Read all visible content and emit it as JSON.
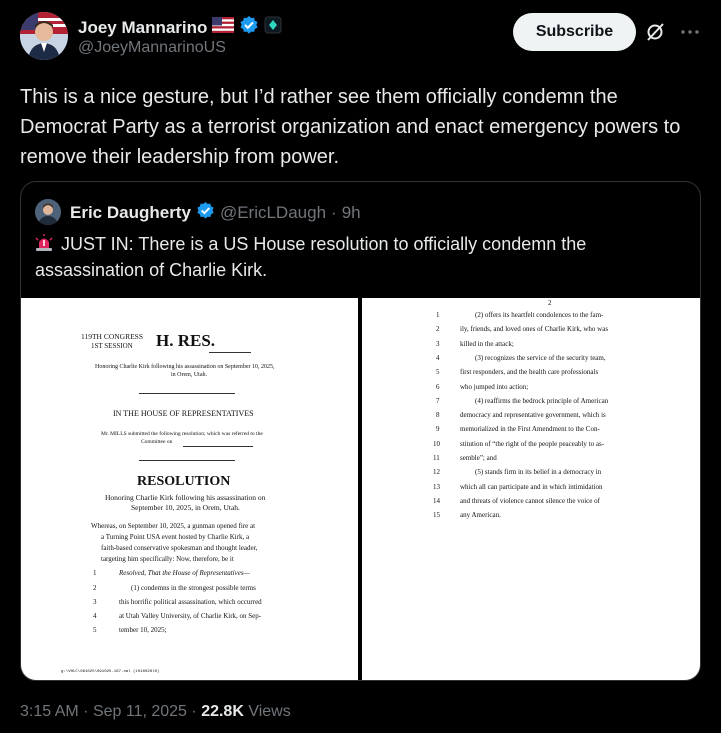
{
  "author": {
    "name": "Joey Mannarino",
    "handle": "@JoeyMannarinoUS"
  },
  "actions": {
    "subscribe_label": "Subscribe",
    "more_icon": "more-icon",
    "grok_icon": "grok-icon"
  },
  "tweet_text": "This is a nice gesture, but I’d rather see them officially condemn the Democrat Party as a terrorist organization and enact emergency powers to remove their leadership from power.",
  "quote": {
    "name": "Eric Daugherty",
    "handle": "@EricLDaugh",
    "sep": "·",
    "time": "9h",
    "text": "JUST IN: There is a US House resolution to officially condemn the assassination of Charlie Kirk."
  },
  "doc1": {
    "congress_line1": "119TH CONGRESS",
    "congress_line2": "1ST SESSION",
    "hres": "H. RES.",
    "subtitle_line1": "Honoring Charlie Kirk following his assassination on September 10, 2025,",
    "subtitle_line2": "in Orem, Utah.",
    "house": "IN THE HOUSE OF REPRESENTATIVES",
    "submitted_line1": "Mr. MILLS submitted the following resolution; which was referred to the",
    "submitted_line2": "Committee on",
    "resolution": "RESOLUTION",
    "honoring_line1": "Honoring Charlie Kirk following his assassination on",
    "honoring_line2": "September 10, 2025, in Orem, Utah.",
    "whereas": [
      "Whereas, on September 10, 2025, a gunman opened fire at",
      "a Turning Point USA event hosted by Charlie Kirk, a",
      "faith-based conservative spokesman and thought leader,",
      "targeting him specifically: Now, therefore, be it"
    ],
    "numbered": [
      {
        "n": "1",
        "t": "Resolved, That the House of Representatives—"
      },
      {
        "n": "2",
        "t": "(1) condemns in the strongest possible terms"
      },
      {
        "n": "3",
        "t": "this horrific political assassination, which occurred"
      },
      {
        "n": "4",
        "t": "at Utah Valley University, of Charlie Kirk, on Sep-"
      },
      {
        "n": "5",
        "t": "tember 10, 2025;"
      }
    ],
    "footer": "g:\\VHLC\\091025\\091025.167.xml          (1010026l0)"
  },
  "doc2": {
    "page_no": "2",
    "lines": [
      {
        "n": "1",
        "t": "(2) offers its heartfelt condolences to the fam-"
      },
      {
        "n": "2",
        "t": "ily, friends, and loved ones of Charlie Kirk, who was"
      },
      {
        "n": "3",
        "t": "killed in the attack;"
      },
      {
        "n": "4",
        "t": "(3) recognizes the service of the security team,"
      },
      {
        "n": "5",
        "t": "first responders, and the health care professionals"
      },
      {
        "n": "6",
        "t": "who jumped into action;"
      },
      {
        "n": "7",
        "t": "(4) reaffirms the bedrock principle of American"
      },
      {
        "n": "8",
        "t": "democracy and representative government, which is"
      },
      {
        "n": "9",
        "t": "memorialized in the First Amendment to the Con-"
      },
      {
        "n": "10",
        "t": "stitution of “the right of the people peaceably to as-"
      },
      {
        "n": "11",
        "t": "semble”; and"
      },
      {
        "n": "12",
        "t": "(5) stands firm in its belief in a democracy in"
      },
      {
        "n": "13",
        "t": "which all can participate and in which intimidation"
      },
      {
        "n": "14",
        "t": "and threats of violence cannot silence the voice of"
      },
      {
        "n": "15",
        "t": "any American."
      }
    ]
  },
  "meta": {
    "time": "3:15 AM",
    "sep1": "·",
    "date": "Sep 11, 2025",
    "sep2": "·",
    "views_count": "22.8K",
    "views_label": "Views"
  },
  "colors": {
    "verified": "#1d9bf0",
    "muted": "#71767b",
    "text": "#e7e9ea",
    "border": "#2f3336"
  }
}
